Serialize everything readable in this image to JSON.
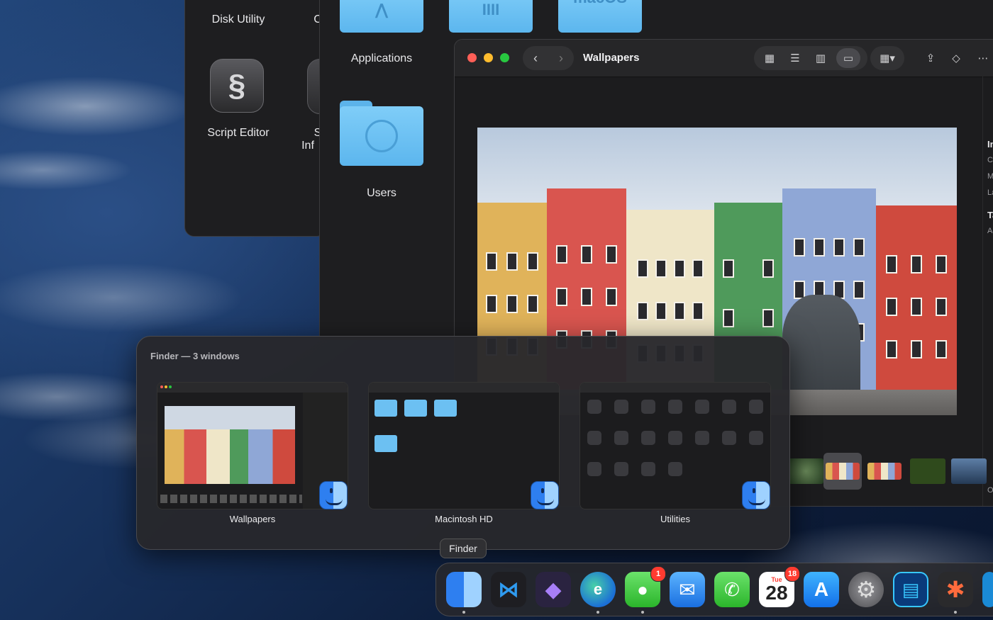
{
  "utilities_window": {
    "disk_utility_label": "Disk Utility",
    "script_editor_label": "Script Editor",
    "partial_label_1": "C",
    "partial_label_2": "S",
    "partial_label_3": "Inf"
  },
  "hd_window": {
    "applications_label": "Applications",
    "users_label": "Users",
    "macos_folder_text": "macOS"
  },
  "wallpapers_window": {
    "title": "Wallpapers",
    "back_glyph": "‹",
    "forward_glyph": "›",
    "right_panel_letters": [
      "In",
      "Cr",
      "M",
      "La",
      "Ta",
      "Ad",
      "O"
    ]
  },
  "switcher": {
    "title": "Finder — 3 windows",
    "cards": [
      {
        "label": "Wallpapers"
      },
      {
        "label": "Macintosh HD"
      },
      {
        "label": "Utilities"
      }
    ]
  },
  "dock": {
    "tooltip": "Finder",
    "calendar_day": "28",
    "calendar_weekday": "Tue",
    "messages_badge": "1",
    "calendar_badge": "18",
    "apps": [
      "finder-icon",
      "vscode-icon",
      "obsidian-icon",
      "edge-icon",
      "messages-icon",
      "mail-icon",
      "phone-icon",
      "calendar-icon",
      "app-store-icon",
      "system-settings-icon",
      "reader-icon",
      "claude-icon"
    ]
  },
  "colors": {
    "folder_blue": "#6cc0f2",
    "close": "#ff5f57",
    "minimize": "#febc2e",
    "zoom": "#28c840",
    "badge_red": "#ff3b30"
  }
}
